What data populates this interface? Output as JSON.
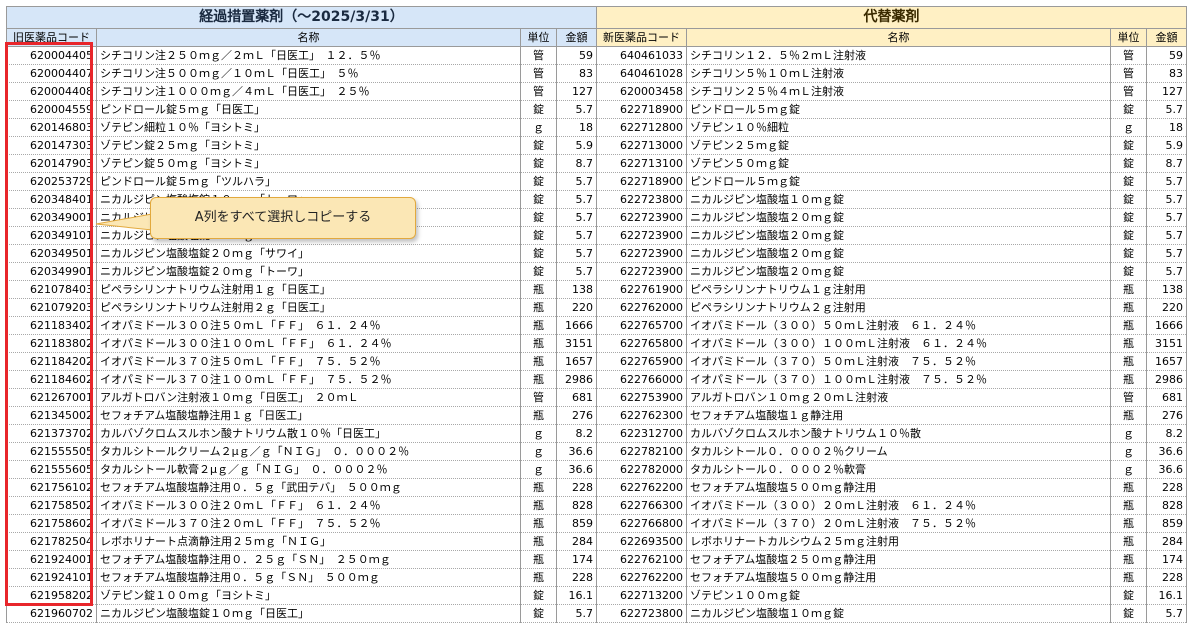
{
  "header": {
    "group_old": "経過措置薬剤（〜2025/3/31）",
    "group_new": "代替薬剤",
    "cols": [
      "旧医薬品コード",
      "名称",
      "単位",
      "金額",
      "新医薬品コード",
      "名称",
      "単位",
      "金額"
    ]
  },
  "callout": {
    "text": "A列をすべて選択しコピーする"
  },
  "rows": [
    [
      "620004405",
      "シチコリン注２５０ｍｇ／２ｍＬ「日医工」　１２．５％",
      "管",
      "59",
      "640461033",
      "シチコリン１２．５％２ｍＬ注射液",
      "管",
      "59"
    ],
    [
      "620004407",
      "シチコリン注５００ｍｇ／１０ｍＬ「日医工」　５％",
      "管",
      "83",
      "640461028",
      "シチコリン５％１０ｍＬ注射液",
      "管",
      "83"
    ],
    [
      "620004408",
      "シチコリン注１０００ｍｇ／４ｍＬ「日医工」　２５％",
      "管",
      "127",
      "620003458",
      "シチコリン２５％４ｍＬ注射液",
      "管",
      "127"
    ],
    [
      "620004559",
      "ピンドロール錠５ｍｇ「日医工」",
      "錠",
      "5.7",
      "622718900",
      "ピンドロール５ｍｇ錠",
      "錠",
      "5.7"
    ],
    [
      "620146803",
      "ゾテピン細粒１０％「ヨシトミ」",
      "ｇ",
      "18",
      "622712800",
      "ゾテピン１０％細粒",
      "ｇ",
      "18"
    ],
    [
      "620147303",
      "ゾテピン錠２５ｍｇ「ヨシトミ」",
      "錠",
      "5.9",
      "622713000",
      "ゾテピン２５ｍｇ錠",
      "錠",
      "5.9"
    ],
    [
      "620147903",
      "ゾテピン錠５０ｍｇ「ヨシトミ」",
      "錠",
      "8.7",
      "622713100",
      "ゾテピン５０ｍｇ錠",
      "錠",
      "8.7"
    ],
    [
      "620253729",
      "ピンドロール錠５ｍｇ「ツルハラ」",
      "錠",
      "5.7",
      "622718900",
      "ピンドロール５ｍｇ錠",
      "錠",
      "5.7"
    ],
    [
      "620348401",
      "ニカルジピン塩酸塩錠１０ｍｇ「トーワ」",
      "錠",
      "5.7",
      "622723800",
      "ニカルジピン塩酸塩１０ｍｇ錠",
      "錠",
      "5.7"
    ],
    [
      "620349001",
      "ニカルジピン塩酸塩錠２０ｍｇ",
      "錠",
      "5.7",
      "622723900",
      "ニカルジピン塩酸塩２０ｍｇ錠",
      "錠",
      "5.7"
    ],
    [
      "620349101",
      "ニカルジピン塩酸塩錠２０ｍｇ",
      "錠",
      "5.7",
      "622723900",
      "ニカルジピン塩酸塩２０ｍｇ錠",
      "錠",
      "5.7"
    ],
    [
      "620349501",
      "ニカルジピン塩酸塩錠２０ｍｇ「サワイ」",
      "錠",
      "5.7",
      "622723900",
      "ニカルジピン塩酸塩２０ｍｇ錠",
      "錠",
      "5.7"
    ],
    [
      "620349901",
      "ニカルジピン塩酸塩錠２０ｍｇ「トーワ」",
      "錠",
      "5.7",
      "622723900",
      "ニカルジピン塩酸塩２０ｍｇ錠",
      "錠",
      "5.7"
    ],
    [
      "621078403",
      "ピペラシリンナトリウム注射用１ｇ「日医工」",
      "瓶",
      "138",
      "622761900",
      "ピペラシリンナトリウム１ｇ注射用",
      "瓶",
      "138"
    ],
    [
      "621079203",
      "ピペラシリンナトリウム注射用２ｇ「日医工」",
      "瓶",
      "220",
      "622762000",
      "ピペラシリンナトリウム２ｇ注射用",
      "瓶",
      "220"
    ],
    [
      "621183402",
      "イオパミドール３００注５０ｍＬ「ＦＦ」　６１．２４％",
      "瓶",
      "1666",
      "622765700",
      "イオパミドール（３００）５０ｍＬ注射液　６１．２４％",
      "瓶",
      "1666"
    ],
    [
      "621183802",
      "イオパミドール３００注１００ｍＬ「ＦＦ」　６１．２４％",
      "瓶",
      "3151",
      "622765800",
      "イオパミドール（３００）１００ｍＬ注射液　６１．２４％",
      "瓶",
      "3151"
    ],
    [
      "621184202",
      "イオパミドール３７０注５０ｍＬ「ＦＦ」　７５．５２％",
      "瓶",
      "1657",
      "622765900",
      "イオパミドール（３７０）５０ｍＬ注射液　７５．５２％",
      "瓶",
      "1657"
    ],
    [
      "621184602",
      "イオパミドール３７０注１００ｍＬ「ＦＦ」　７５．５２％",
      "瓶",
      "2986",
      "622766000",
      "イオパミドール（３７０）１００ｍＬ注射液　７５．５２％",
      "瓶",
      "2986"
    ],
    [
      "621267001",
      "アルガトロバン注射液１０ｍｇ「日医工」　２０ｍＬ",
      "管",
      "681",
      "622753900",
      "アルガトロバン１０ｍｇ２０ｍＬ注射液",
      "管",
      "681"
    ],
    [
      "621345002",
      "セフォチアム塩酸塩静注用１ｇ「日医工」",
      "瓶",
      "276",
      "622762300",
      "セフォチアム塩酸塩１ｇ静注用",
      "瓶",
      "276"
    ],
    [
      "621373702",
      "カルバゾクロムスルホン酸ナトリウム散１０％「日医工」",
      "ｇ",
      "8.2",
      "622312700",
      "カルバゾクロムスルホン酸ナトリウム１０％散",
      "ｇ",
      "8.2"
    ],
    [
      "621555505",
      "タカルシトールクリーム２μｇ／ｇ「ＮＩＧ」　０．０００２％",
      "ｇ",
      "36.6",
      "622782100",
      "タカルシトール０．０００２％クリーム",
      "ｇ",
      "36.6"
    ],
    [
      "621555605",
      "タカルシトール軟膏２μｇ／ｇ「ＮＩＧ」　０．０００２％",
      "ｇ",
      "36.6",
      "622782000",
      "タカルシトール０．０００２％軟膏",
      "ｇ",
      "36.6"
    ],
    [
      "621756102",
      "セフォチアム塩酸塩静注用０．５ｇ「武田テバ」　５００ｍｇ",
      "瓶",
      "228",
      "622762200",
      "セフォチアム塩酸塩５００ｍｇ静注用",
      "瓶",
      "228"
    ],
    [
      "621758502",
      "イオパミドール３００注２０ｍＬ「ＦＦ」　６１．２４％",
      "瓶",
      "828",
      "622766300",
      "イオパミドール（３００）２０ｍＬ注射液　６１．２４％",
      "瓶",
      "828"
    ],
    [
      "621758602",
      "イオパミドール３７０注２０ｍＬ「ＦＦ」　７５．５２％",
      "瓶",
      "859",
      "622766800",
      "イオパミドール（３７０）２０ｍＬ注射液　７５．５２％",
      "瓶",
      "859"
    ],
    [
      "621782504",
      "レボホリナート点滴静注用２５ｍｇ「ＮＩＧ」",
      "瓶",
      "284",
      "622693500",
      "レボホリナートカルシウム２５ｍｇ注射用",
      "瓶",
      "284"
    ],
    [
      "621924001",
      "セフォチアム塩酸塩静注用０．２５ｇ「ＳＮ」　２５０ｍｇ",
      "瓶",
      "174",
      "622762100",
      "セフォチアム塩酸塩２５０ｍｇ静注用",
      "瓶",
      "174"
    ],
    [
      "621924101",
      "セフォチアム塩酸塩静注用０．５ｇ「ＳＮ」　５００ｍｇ",
      "瓶",
      "228",
      "622762200",
      "セフォチアム塩酸塩５００ｍｇ静注用",
      "瓶",
      "228"
    ],
    [
      "621958202",
      "ゾテピン錠１００ｍｇ「ヨシトミ」",
      "錠",
      "16.1",
      "622713200",
      "ゾテピン１００ｍｇ錠",
      "錠",
      "16.1"
    ],
    [
      "621960702",
      "ニカルジピン塩酸塩錠１０ｍｇ「日医工」",
      "錠",
      "5.7",
      "622723800",
      "ニカルジピン塩酸塩１０ｍｇ錠",
      "錠",
      "5.7"
    ]
  ]
}
